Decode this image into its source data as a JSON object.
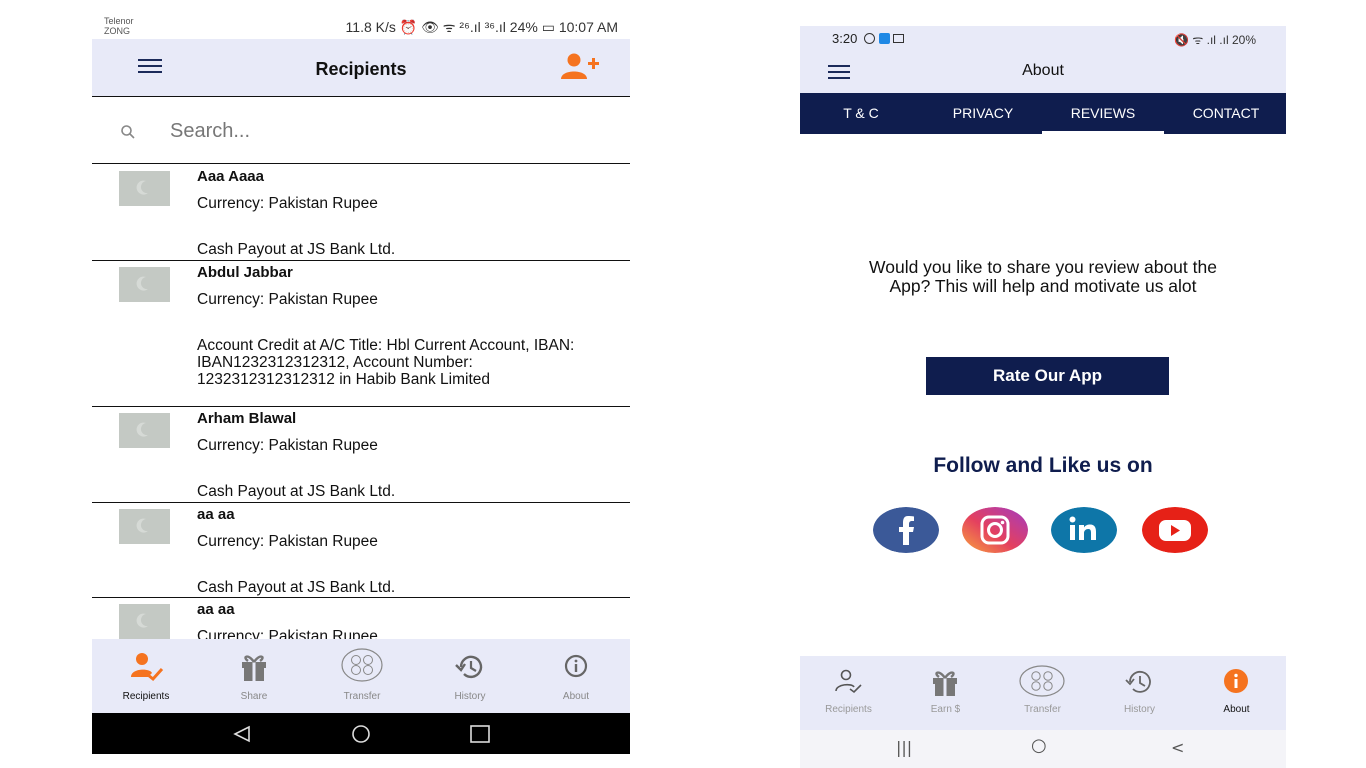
{
  "left_phone": {
    "status": {
      "carrier_1": "Telenor",
      "carrier_2": "ZONG",
      "right_text": "11.8 K/s ⏰ 👁 ᯤ ²⁶.ıl ³⁶.ıl 24% ▭ 10:07 AM"
    },
    "appbar": {
      "title": "Recipients",
      "menu_icon": "hamburger-icon",
      "add_icon": "add-user-icon",
      "accent": "#f5731f"
    },
    "search": {
      "placeholder": "Search..."
    },
    "recipients": [
      {
        "name": "Aaa Aaaa",
        "currency": "Currency: Pakistan Rupee",
        "payout": "Cash Payout at JS Bank Ltd."
      },
      {
        "name": "Abdul Jabbar",
        "currency": "Currency: Pakistan Rupee",
        "payout": "Account Credit at A/C Title: Hbl Current Account, IBAN: IBAN1232312312312, Account Number: 1232312312312312 in Habib Bank Limited"
      },
      {
        "name": "Arham Blawal",
        "currency": "Currency: Pakistan Rupee",
        "payout": "Cash Payout at JS Bank Ltd."
      },
      {
        "name": "aa aa",
        "currency": "Currency: Pakistan Rupee",
        "payout": "Cash Payout at JS Bank Ltd."
      },
      {
        "name": "aa aa",
        "currency": "Currency: Pakistan Rupee",
        "payout": ""
      }
    ],
    "bottom_nav": [
      {
        "label": "Recipients",
        "icon": "recipients-icon",
        "active": true
      },
      {
        "label": "Share",
        "icon": "gift-icon",
        "active": false
      },
      {
        "label": "Transfer",
        "icon": "currency-exchange-icon",
        "active": false
      },
      {
        "label": "History",
        "icon": "history-icon",
        "active": false
      },
      {
        "label": "About",
        "icon": "info-icon",
        "active": false
      }
    ]
  },
  "right_phone": {
    "status": {
      "time": "3:20",
      "right_text": "🔇 ᯤ .ıl .ıl 20%"
    },
    "appbar": {
      "title": "About"
    },
    "tabs": [
      {
        "label": "T & C"
      },
      {
        "label": "PRIVACY"
      },
      {
        "label": "REVIEWS",
        "active": true
      },
      {
        "label": "CONTACT"
      }
    ],
    "review": {
      "text": "Would you like to share you review about the App? This will help and motivate us alot",
      "button": "Rate Our App"
    },
    "follow_title": "Follow and Like us on",
    "social": [
      {
        "name": "facebook",
        "color": "#3b5998"
      },
      {
        "name": "instagram",
        "color": "#d6249f"
      },
      {
        "name": "linkedin",
        "color": "#0e76a8"
      },
      {
        "name": "youtube",
        "color": "#e62117"
      }
    ],
    "bottom_nav": [
      {
        "label": "Recipients",
        "icon": "recipients-icon",
        "active": false
      },
      {
        "label": "Earn $",
        "icon": "gift-icon",
        "active": false
      },
      {
        "label": "Transfer",
        "icon": "currency-exchange-icon",
        "active": false
      },
      {
        "label": "History",
        "icon": "history-icon",
        "active": false
      },
      {
        "label": "About",
        "icon": "info-icon",
        "active": true
      }
    ],
    "sys_nav": {
      "recents": "|||",
      "home": "○",
      "back": "<"
    }
  }
}
